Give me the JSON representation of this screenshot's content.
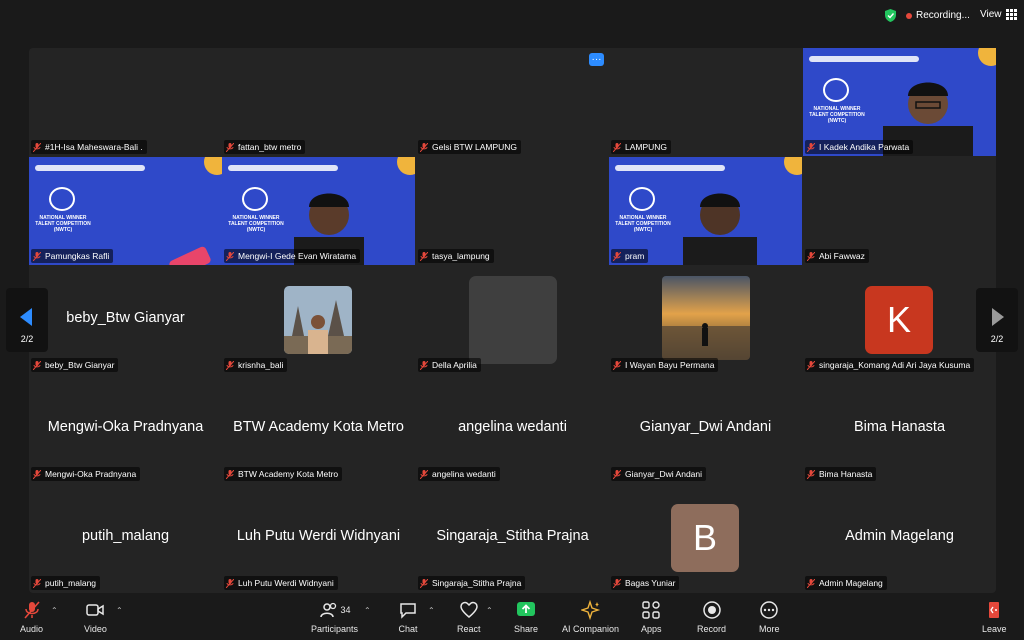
{
  "topbar": {
    "recording_label": "Recording...",
    "view_label": "View"
  },
  "pagination": {
    "left": "2/2",
    "right": "2/2"
  },
  "video_tiles": [
    {
      "name": "#1H-Isa Maheswara-Bali ."
    },
    {
      "name": "fattan_btw metro"
    },
    {
      "name": "Gelsi BTW LAMPUNG"
    },
    {
      "name": "LAMPUNG"
    },
    {
      "name": "I Kadek Andika Parwata"
    },
    {
      "name": "Pamungkas Rafli"
    },
    {
      "name": "Mengwi-I Gede Evan Wiratama"
    },
    {
      "name": "tasya_lampung"
    },
    {
      "name": "pram"
    },
    {
      "name": "Abi Fawwaz"
    }
  ],
  "banner_text": "NATIONAL WINNER TALENT COMPETITION (NWTC)",
  "name_tiles": [
    {
      "big": "beby_Btw Gianyar",
      "label": "beby_Btw Gianyar"
    },
    {
      "big": "",
      "label": "krisnha_bali"
    },
    {
      "big": "",
      "label": "Della Aprilia"
    },
    {
      "big": "",
      "label": "I Wayan Bayu Permana"
    },
    {
      "big": "",
      "label": "singaraja_Komang Adi Ari Jaya Kusuma",
      "letter": "K"
    },
    {
      "big": "Mengwi-Oka Pradnyana",
      "label": "Mengwi-Oka Pradnyana"
    },
    {
      "big": "BTW Academy Kota Metro",
      "label": "BTW Academy Kota Metro"
    },
    {
      "big": "angelina wedanti",
      "label": "angelina wedanti"
    },
    {
      "big": "Gianyar_Dwi Andani",
      "label": "Gianyar_Dwi Andani"
    },
    {
      "big": "Bima Hanasta",
      "label": "Bima Hanasta"
    },
    {
      "big": "putih_malang",
      "label": "putih_malang"
    },
    {
      "big": "Luh Putu Werdi Widnyani",
      "label": "Luh Putu Werdi Widnyani"
    },
    {
      "big": "Singaraja_Stitha Prajna",
      "label": "Singaraja_Stitha Prajna"
    },
    {
      "big": "",
      "label": "Bagas Yuniar",
      "letter": "B"
    },
    {
      "big": "Admin Magelang",
      "label": "Admin Magelang"
    }
  ],
  "toolbar": {
    "audio": "Audio",
    "video": "Video",
    "participants": "Participants",
    "participants_count": "34",
    "chat": "Chat",
    "react": "React",
    "share": "Share",
    "ai_companion": "AI Companion",
    "apps": "Apps",
    "record": "Record",
    "more": "More",
    "leave": "Leave"
  },
  "colors": {
    "accent": "#2d8cff",
    "share_green": "#22c55e",
    "leave_red": "#e5483b",
    "avatar_k": "#c8371f",
    "avatar_b": "#8e6d5c"
  }
}
